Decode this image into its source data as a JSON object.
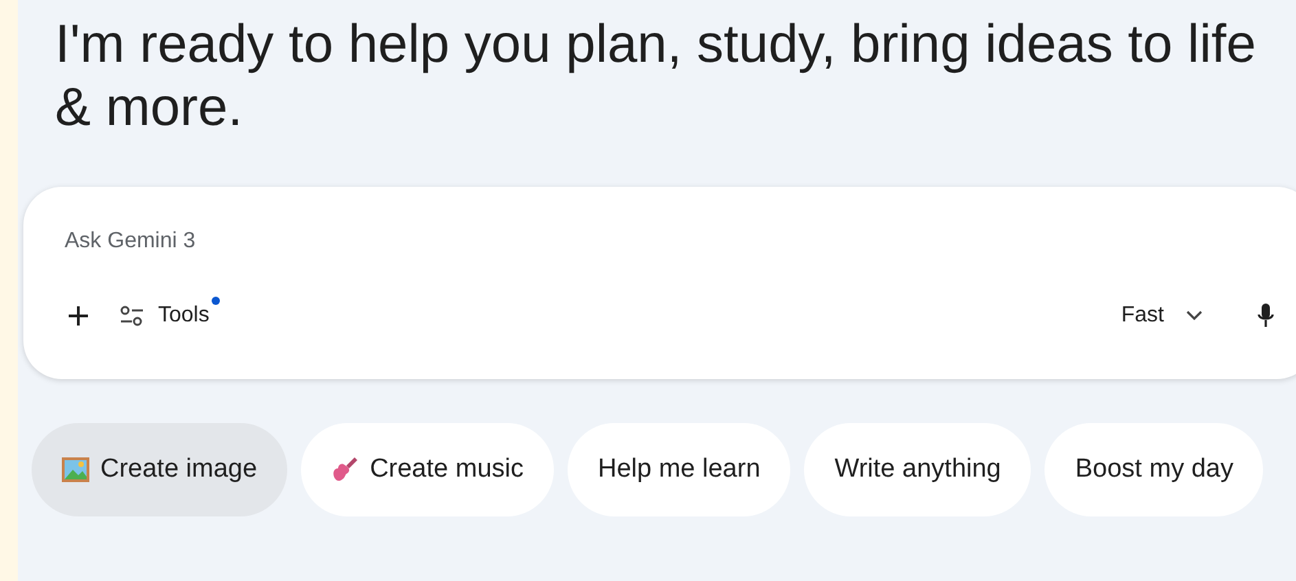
{
  "heading": "I'm ready to help you plan, study, bring ideas to life & more.",
  "prompt": {
    "placeholder": "Ask Gemini 3",
    "tools_label": "Tools",
    "tools_badge": true,
    "mode": "Fast"
  },
  "chips": [
    {
      "label": "Create image",
      "kind": "image",
      "selected": true
    },
    {
      "label": "Create music",
      "kind": "guitar",
      "selected": false
    },
    {
      "label": "Help me learn",
      "kind": "plain",
      "selected": false
    },
    {
      "label": "Write anything",
      "kind": "plain",
      "selected": false
    },
    {
      "label": "Boost my day",
      "kind": "plain",
      "selected": false
    }
  ]
}
